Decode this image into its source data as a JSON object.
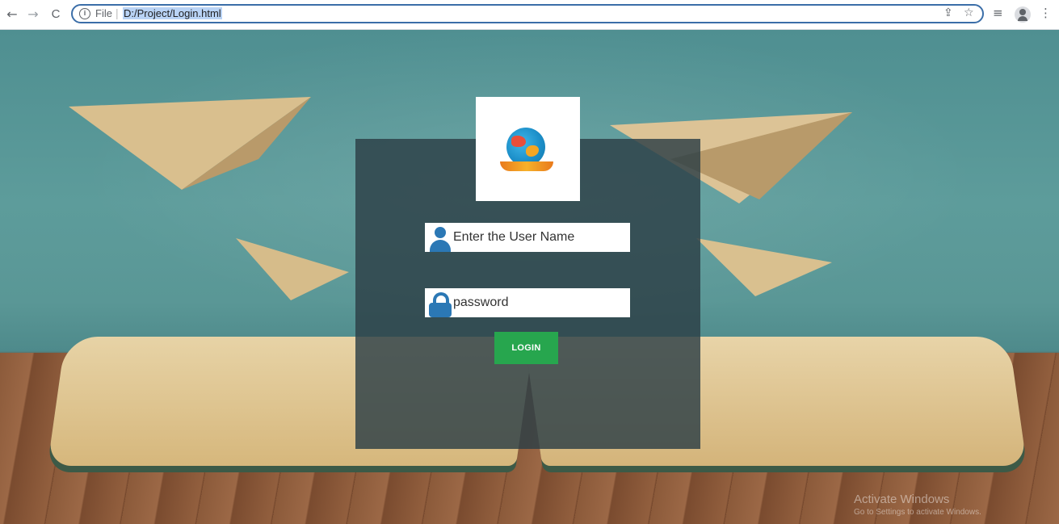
{
  "browser": {
    "back_icon": "←",
    "forward_icon": "→",
    "reload_icon": "C",
    "info_icon": "i",
    "scheme_label": "File",
    "separator": "|",
    "url": "D:/Project/Login.html",
    "share_icon": "⇪",
    "star_icon": "☆",
    "reading_list_icon": "≡",
    "menu_icon": "⋮"
  },
  "login": {
    "username_placeholder": "Enter the User Name",
    "password_placeholder": "password",
    "login_button": "LOGIN"
  },
  "watermark": {
    "title": "Activate Windows",
    "subtitle": "Go to Settings to activate Windows."
  },
  "colors": {
    "panel": "#2c3e46",
    "button": "#27a64e",
    "icon": "#2b78b5"
  }
}
